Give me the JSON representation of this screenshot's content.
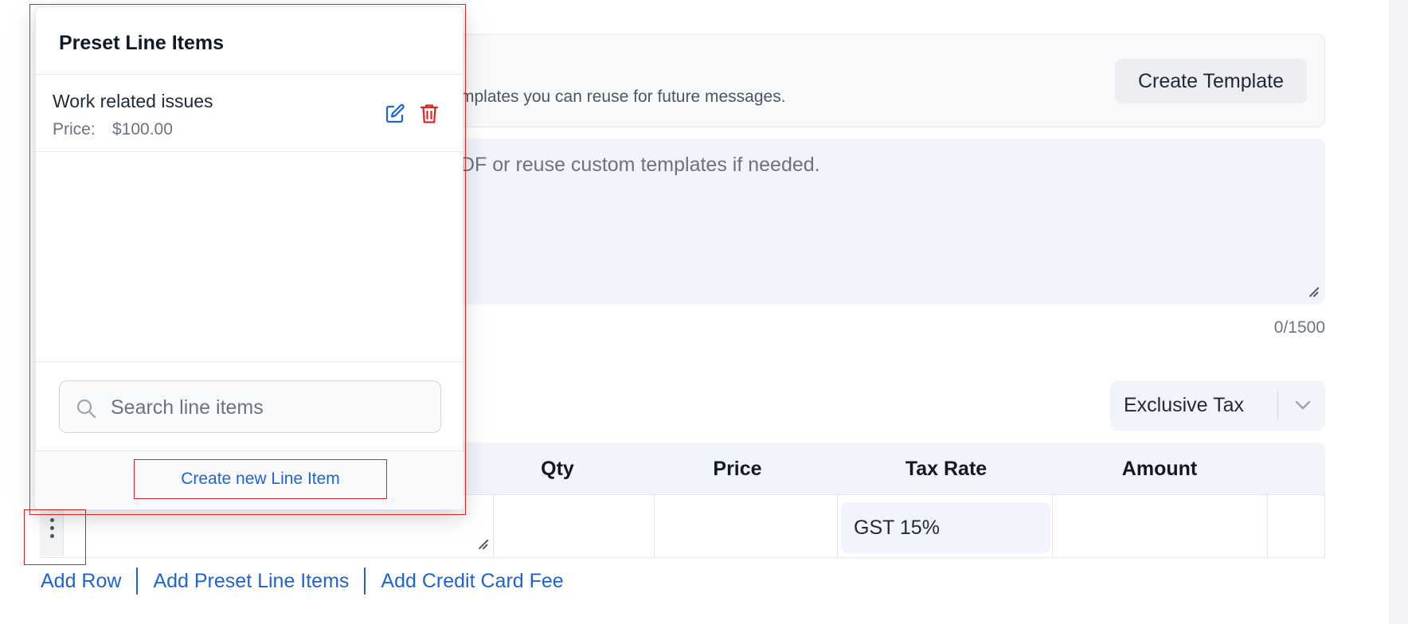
{
  "template_section": {
    "description": "mplates you can reuse for future messages.",
    "create_template_label": "Create Template"
  },
  "message": {
    "placeholder_fragment": "DF or reuse custom templates if needed.",
    "char_count": "0/1500"
  },
  "tax_select": {
    "value": "Exclusive Tax"
  },
  "table": {
    "headers": [
      "Qty",
      "Price",
      "Tax Rate",
      "Amount"
    ],
    "row": {
      "tax_rate": "GST 15%"
    }
  },
  "bottom_links": {
    "add_row": "Add Row",
    "add_preset": "Add Preset Line Items",
    "add_cc_fee": "Add Credit Card Fee"
  },
  "popover": {
    "title": "Preset Line Items",
    "items": [
      {
        "name": "Work related issues",
        "price_label": "Price:",
        "price": "$100.00"
      }
    ],
    "search_placeholder": "Search line items",
    "create_label": "Create new Line Item"
  },
  "colors": {
    "accent": "#1d63d8",
    "danger": "#e02424",
    "surface": "#f1f4fb"
  },
  "icons": [
    "edit-icon",
    "trash-icon",
    "search-icon",
    "chevron-down-icon",
    "kebab-icon",
    "resize-grip-icon"
  ]
}
